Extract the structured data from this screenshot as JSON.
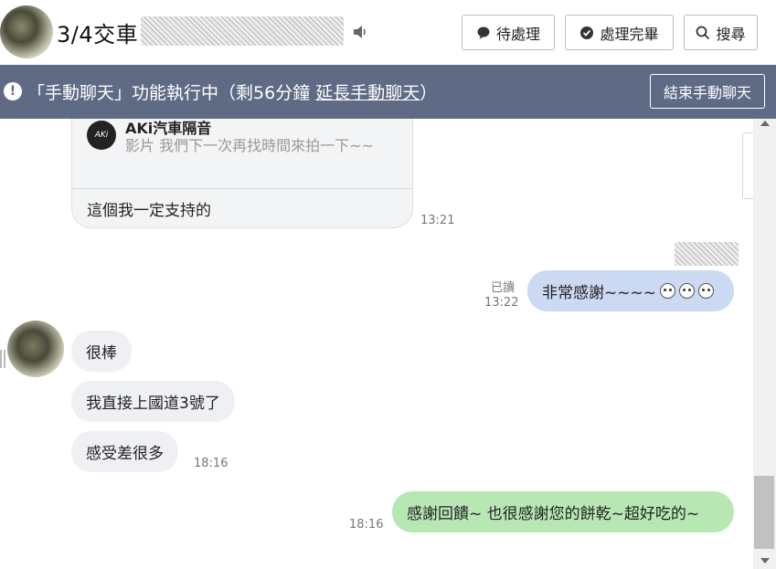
{
  "header": {
    "title": "3/4交車",
    "buttons": {
      "pending": "待處理",
      "done": "處理完畢",
      "search": "搜尋"
    }
  },
  "banner": {
    "text_prefix": "「手動聊天」功能執行中（剩",
    "remaining": "56",
    "text_mid": "分鐘 ",
    "extend_link": "延長手動聊天",
    "text_suffix": "）",
    "end_button": "結束手動聊天"
  },
  "chat": {
    "card": {
      "title": "AKi汽車隔音",
      "description": "影片 我們下一次再找時間來拍一下~~",
      "reply": "這個我一定支持的",
      "time": "13:21"
    },
    "msg_outgoing_1": {
      "read_label": "已讀",
      "time": "13:22",
      "text": "非常感謝~~~~"
    },
    "incoming": [
      {
        "text": "很棒"
      },
      {
        "text": "我直接上國道3號了"
      },
      {
        "text": "感受差很多",
        "time": "18:16"
      }
    ],
    "msg_outgoing_2": {
      "time": "18:16",
      "text": "感謝回饋~ 也很感謝您的餅乾~超好吃的~"
    }
  }
}
